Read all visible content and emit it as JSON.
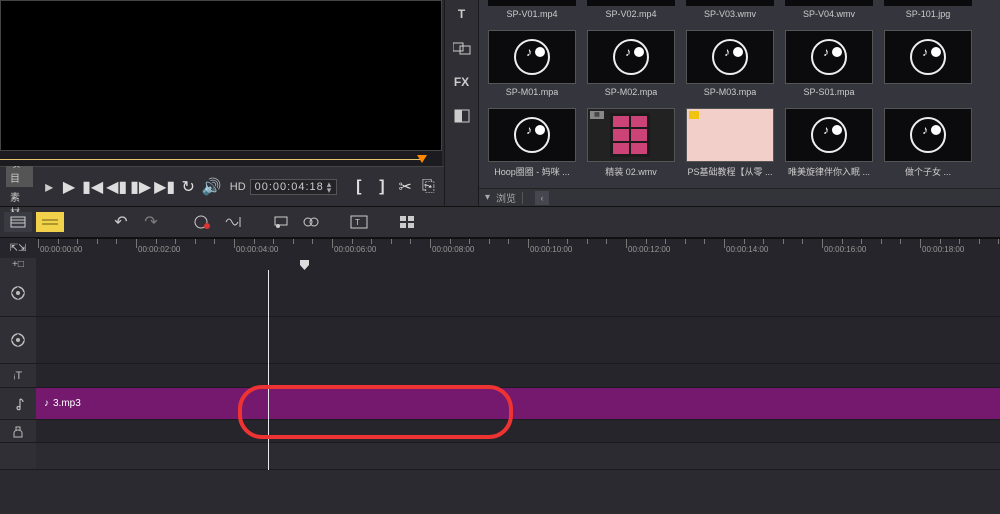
{
  "preview": {
    "tabs": {
      "project": "项目",
      "material": "素材"
    },
    "hd_label": "HD",
    "timecode": "00:00:04:18",
    "bracket_left": "[",
    "bracket_right": "]"
  },
  "asset_panel": {
    "footer_label": "浏览",
    "row0_captions": [
      "SP-V01.mp4",
      "SP-V02.mp4",
      "SP-V03.wmv",
      "SP-V04.wmv",
      "SP-101.jpg"
    ],
    "row1_captions": [
      "SP-M01.mpa",
      "SP-M02.mpa",
      "SP-M03.mpa",
      "SP-S01.mpa",
      ""
    ],
    "row2_captions": [
      "Hoop圈圈 - 妈咪 ...",
      "精装 02.wmv",
      "PS基础教程【从零 ...",
      "唯美旋律伴你入眠 ...",
      "做个子女 ..."
    ]
  },
  "ruler": {
    "labels": [
      "00:00:00:00",
      "00:00:02:00",
      "00:00:04:00",
      "00:00:06:00",
      "00:00:08:00",
      "00:00:10:00",
      "00:00:12:00",
      "00:00:14:00",
      "00:00:16:00",
      "00:00:18:00"
    ]
  },
  "tracks": {
    "audio_clip_label": "3.mp3"
  },
  "icons": {
    "text": "T",
    "transition": "AB",
    "fx": "FX",
    "color": "◧",
    "scissors": "✂",
    "clipboard": "⎘",
    "play": "▶",
    "pause_first": "▮◀",
    "step_back": "◀▮",
    "step_fwd": "▮▶",
    "pause_last": "▶▮",
    "loop": "↻",
    "volume": "🔊",
    "mic": "🎤",
    "film": "🎞",
    "title_icon": "₸",
    "gear": "⚙"
  }
}
